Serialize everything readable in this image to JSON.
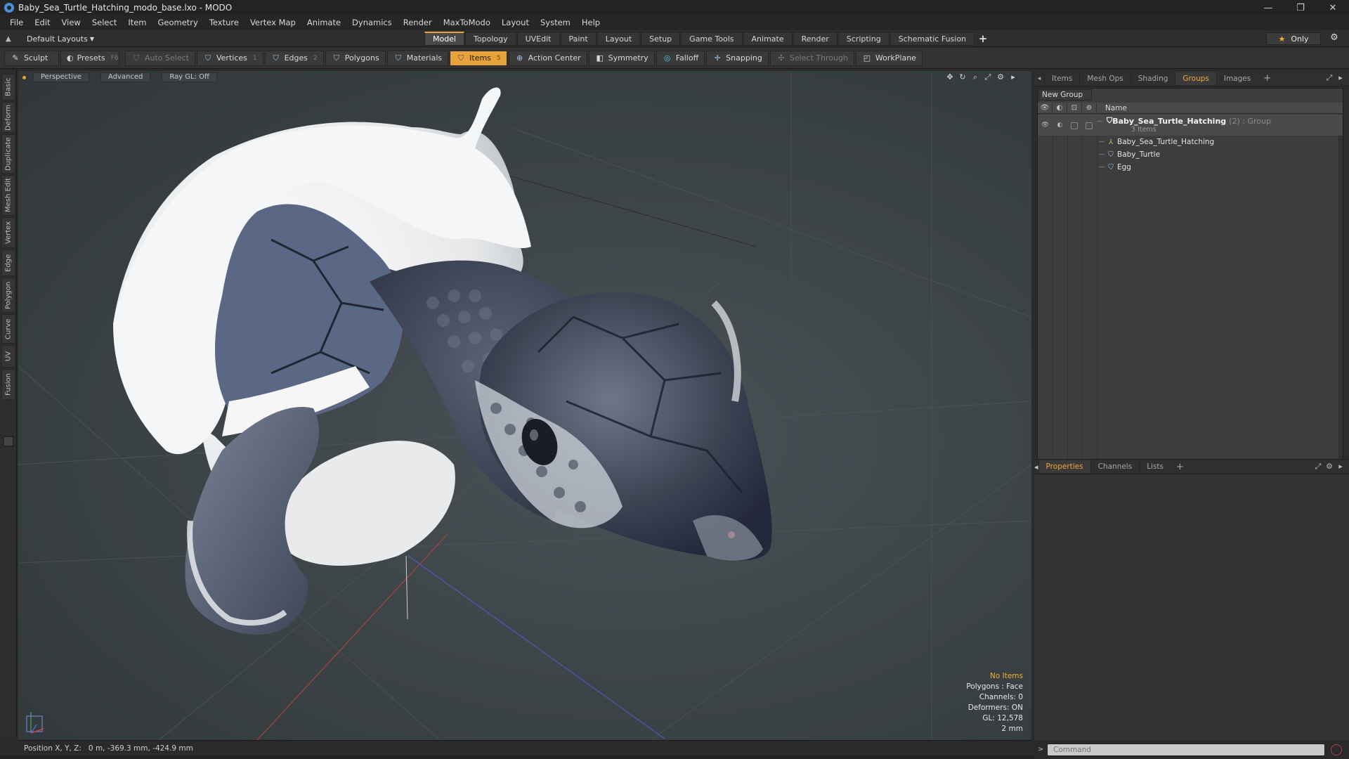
{
  "window": {
    "title": "Baby_Sea_Turtle_Hatching_modo_base.lxo - MODO",
    "minimize": "—",
    "maximize": "❐",
    "close": "✕"
  },
  "menu": [
    "File",
    "Edit",
    "View",
    "Select",
    "Item",
    "Geometry",
    "Texture",
    "Vertex Map",
    "Animate",
    "Dynamics",
    "Render",
    "MaxToModo",
    "Layout",
    "System",
    "Help"
  ],
  "layout": {
    "selector": "Default Layouts",
    "tabs": [
      "Model",
      "Topology",
      "UVEdit",
      "Paint",
      "Layout",
      "Setup",
      "Game Tools",
      "Animate",
      "Render",
      "Scripting",
      "Schematic Fusion"
    ],
    "active_tab": "Model",
    "add_tab": "+",
    "only_label": "Only"
  },
  "toolbar": {
    "sculpt": "Sculpt",
    "presets": "Presets",
    "presets_key": "F6",
    "auto_select": "Auto Select",
    "vertices": "Vertices",
    "vertices_key": "1",
    "edges": "Edges",
    "edges_key": "2",
    "polygons": "Polygons",
    "materials": "Materials",
    "items": "Items",
    "items_key": "5",
    "action_center": "Action Center",
    "symmetry": "Symmetry",
    "falloff": "Falloff",
    "snapping": "Snapping",
    "select_through": "Select Through",
    "workplane": "WorkPlane"
  },
  "left_tabs": [
    "Basic",
    "Deform",
    "Duplicate",
    "Mesh Edit",
    "Vertex",
    "Edge",
    "Polygon",
    "Curve",
    "UV",
    "Fusion"
  ],
  "viewport": {
    "view": "Perspective",
    "shading": "Advanced",
    "raygl": "Ray GL: Off",
    "info": {
      "no_items": "No Items",
      "polygons": "Polygons : Face",
      "channels": "Channels: 0",
      "deformers": "Deformers: ON",
      "gl": "GL: 12,578",
      "scale": "2 mm"
    }
  },
  "status": {
    "position_label": "Position X, Y, Z:",
    "position_value": "0 m, -369.3 mm, -424.9 mm"
  },
  "panel_top": {
    "tabs": [
      "Items",
      "Mesh Ops",
      "Shading",
      "Groups",
      "Images"
    ],
    "active_tab": "Groups",
    "new_group": "New Group",
    "name_col": "Name",
    "group": {
      "name": "Baby_Sea_Turtle_Hatching",
      "meta": "(2) : Group",
      "count": "3 Items"
    },
    "children": [
      "Baby_Sea_Turtle_Hatching",
      "Baby_Turtle",
      "Egg"
    ]
  },
  "panel_bottom": {
    "tabs": [
      "Properties",
      "Channels",
      "Lists"
    ],
    "active_tab": "Properties",
    "command_placeholder": "Command"
  },
  "colors": {
    "accent": "#e8a23a",
    "viewport_bg": "#3b4246",
    "shell": "#f2f2f2",
    "turtle": "#3c4454"
  }
}
